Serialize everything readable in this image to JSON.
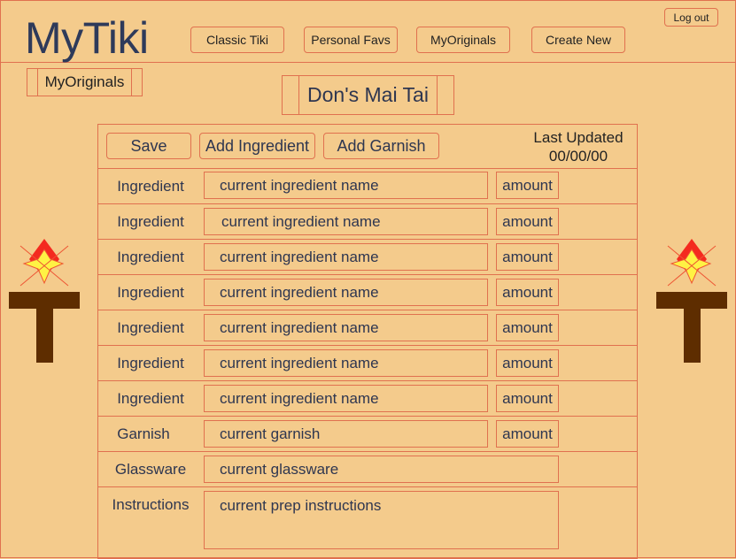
{
  "header": {
    "logo": "MyTiki",
    "nav": [
      "Classic Tiki",
      "Personal Favs",
      "MyOriginals",
      "Create New"
    ],
    "logout": "Log out"
  },
  "breadcrumb": "MyOriginals",
  "recipe": {
    "title": "Don's Mai Tai",
    "actions": {
      "save": "Save",
      "add_ingredient": "Add Ingredient",
      "add_garnish": "Add Garnish"
    },
    "last_updated_label": "Last Updated",
    "last_updated_value": "00/00/00",
    "ingredients": [
      {
        "label": "Ingredient",
        "name": "current ingredient name",
        "amount": "amount"
      },
      {
        "label": "Ingredient",
        "name": "current ingredient name",
        "amount": "amount"
      },
      {
        "label": "Ingredient",
        "name": "current ingredient name",
        "amount": "amount"
      },
      {
        "label": "Ingredient",
        "name": "current ingredient name",
        "amount": "amount"
      },
      {
        "label": "Ingredient",
        "name": "current ingredient name",
        "amount": "amount"
      },
      {
        "label": "Ingredient",
        "name": "current ingredient name",
        "amount": "amount"
      },
      {
        "label": "Ingredient",
        "name": "current ingredient name",
        "amount": "amount"
      }
    ],
    "garnish": {
      "label": "Garnish",
      "value": "current garnish",
      "amount": "amount"
    },
    "glassware": {
      "label": "Glassware",
      "value": "current glassware"
    },
    "instructions": {
      "label": "Instructions",
      "value": "current prep instructions"
    }
  },
  "decor": {
    "left": "tiki-torch-icon",
    "right": "tiki-torch-icon"
  }
}
